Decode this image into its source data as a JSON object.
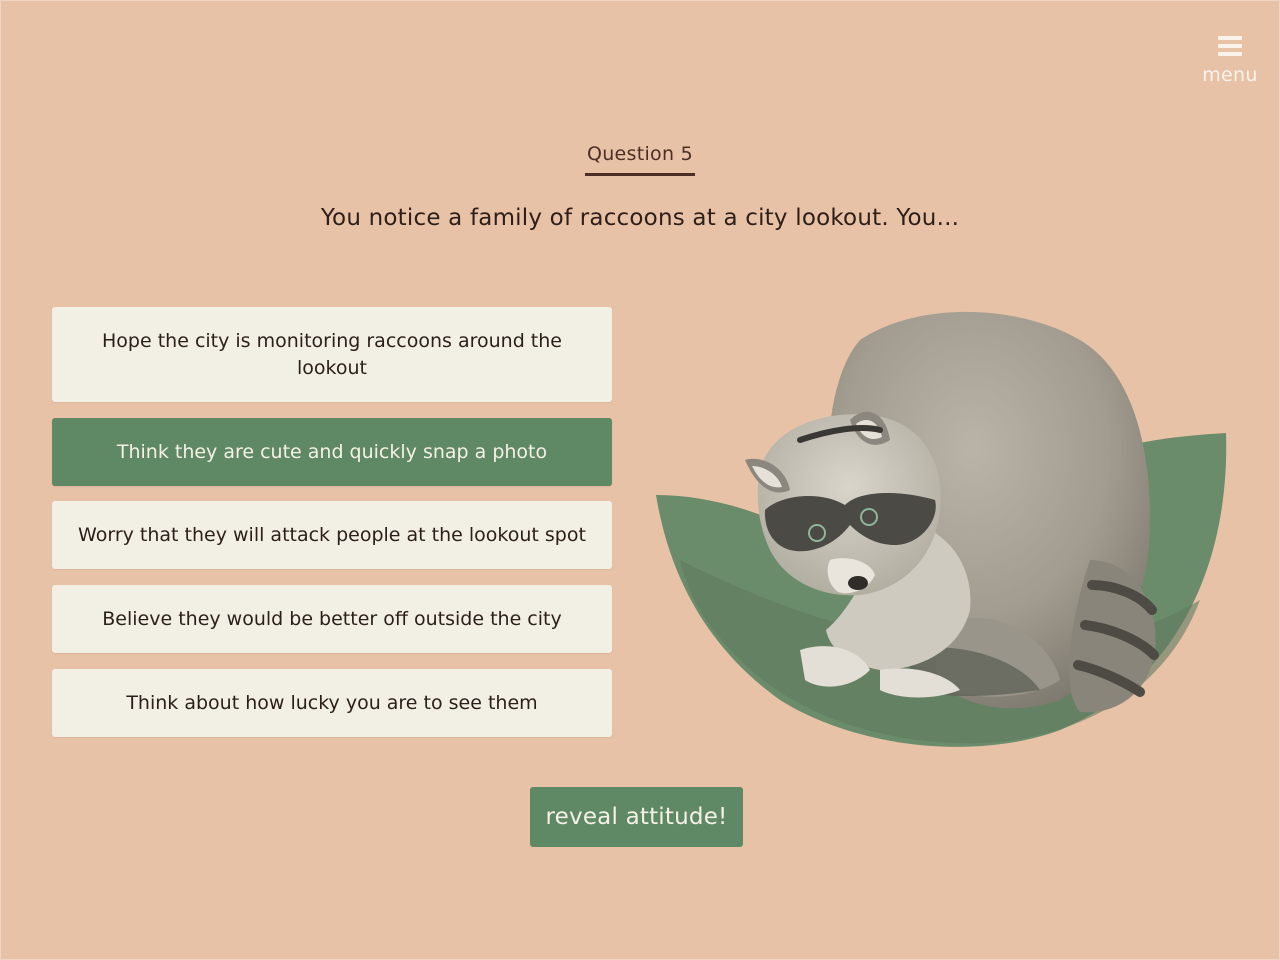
{
  "header": {
    "menu_label": "menu",
    "menu_icon": "hamburger-icon"
  },
  "question": {
    "number_label": "Question 5",
    "text": "You notice a family of raccoons at a city lookout. You..."
  },
  "answers": [
    {
      "label": "Hope the city is monitoring raccoons around the lookout",
      "selected": false
    },
    {
      "label": "Think they are cute and quickly snap a photo",
      "selected": true
    },
    {
      "label": "Worry that they will attack people at the lookout spot",
      "selected": false
    },
    {
      "label": "Believe they would be better off outside the city",
      "selected": false
    },
    {
      "label": "Think about how lucky you are to see them",
      "selected": false
    }
  ],
  "actions": {
    "reveal_label": "reveal attitude!"
  },
  "colors": {
    "background": "#e8c2a7",
    "accent_green": "#5f8864",
    "answer_bg": "#f2efe4",
    "text_dark": "#2e1e18"
  }
}
